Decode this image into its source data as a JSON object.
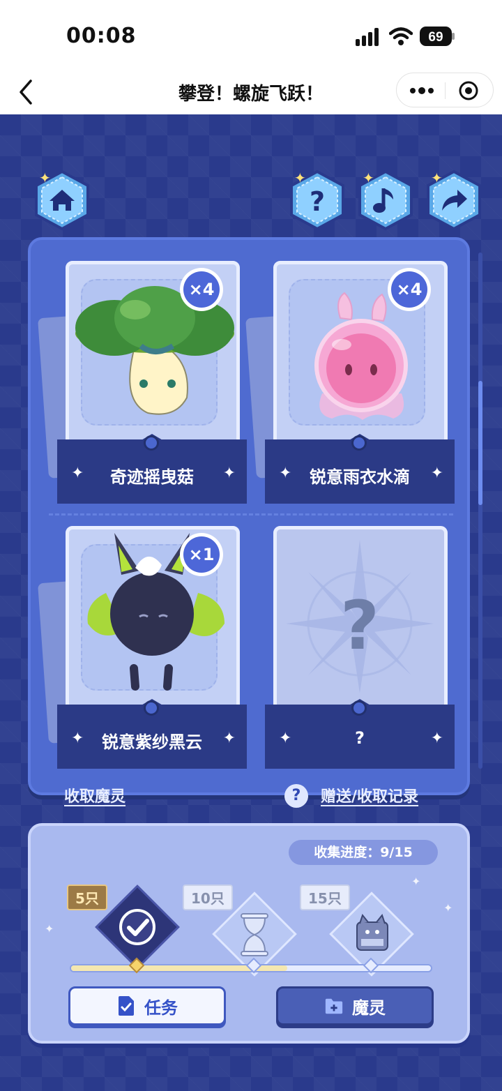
{
  "status_bar": {
    "time": "00:08",
    "battery": "69"
  },
  "nav": {
    "title": "攀登！螺旋飞跃！"
  },
  "cards": [
    {
      "name": "奇迹摇曳菇",
      "count": "×4",
      "locked": false
    },
    {
      "name": "锐意雨衣水滴",
      "count": "×4",
      "locked": false
    },
    {
      "name": "锐意紫纱黑云",
      "count": "×1",
      "locked": false
    },
    {
      "name": "?",
      "count": "",
      "locked": true
    }
  ],
  "links": {
    "collect": "收取魔灵",
    "records": "赠送/收取记录"
  },
  "progress": {
    "label": "收集进度：9/15",
    "collected": 9,
    "total": 15
  },
  "rewards": [
    {
      "tag": "5只",
      "claimed": true
    },
    {
      "tag": "10只",
      "claimed": false
    },
    {
      "tag": "15只",
      "claimed": false
    }
  ],
  "buttons": {
    "task": "任务",
    "spirit": "魔灵"
  },
  "colors": {
    "background": "#2a3a8c",
    "panel": "#4f6bd0",
    "accent": "#3552c8"
  }
}
